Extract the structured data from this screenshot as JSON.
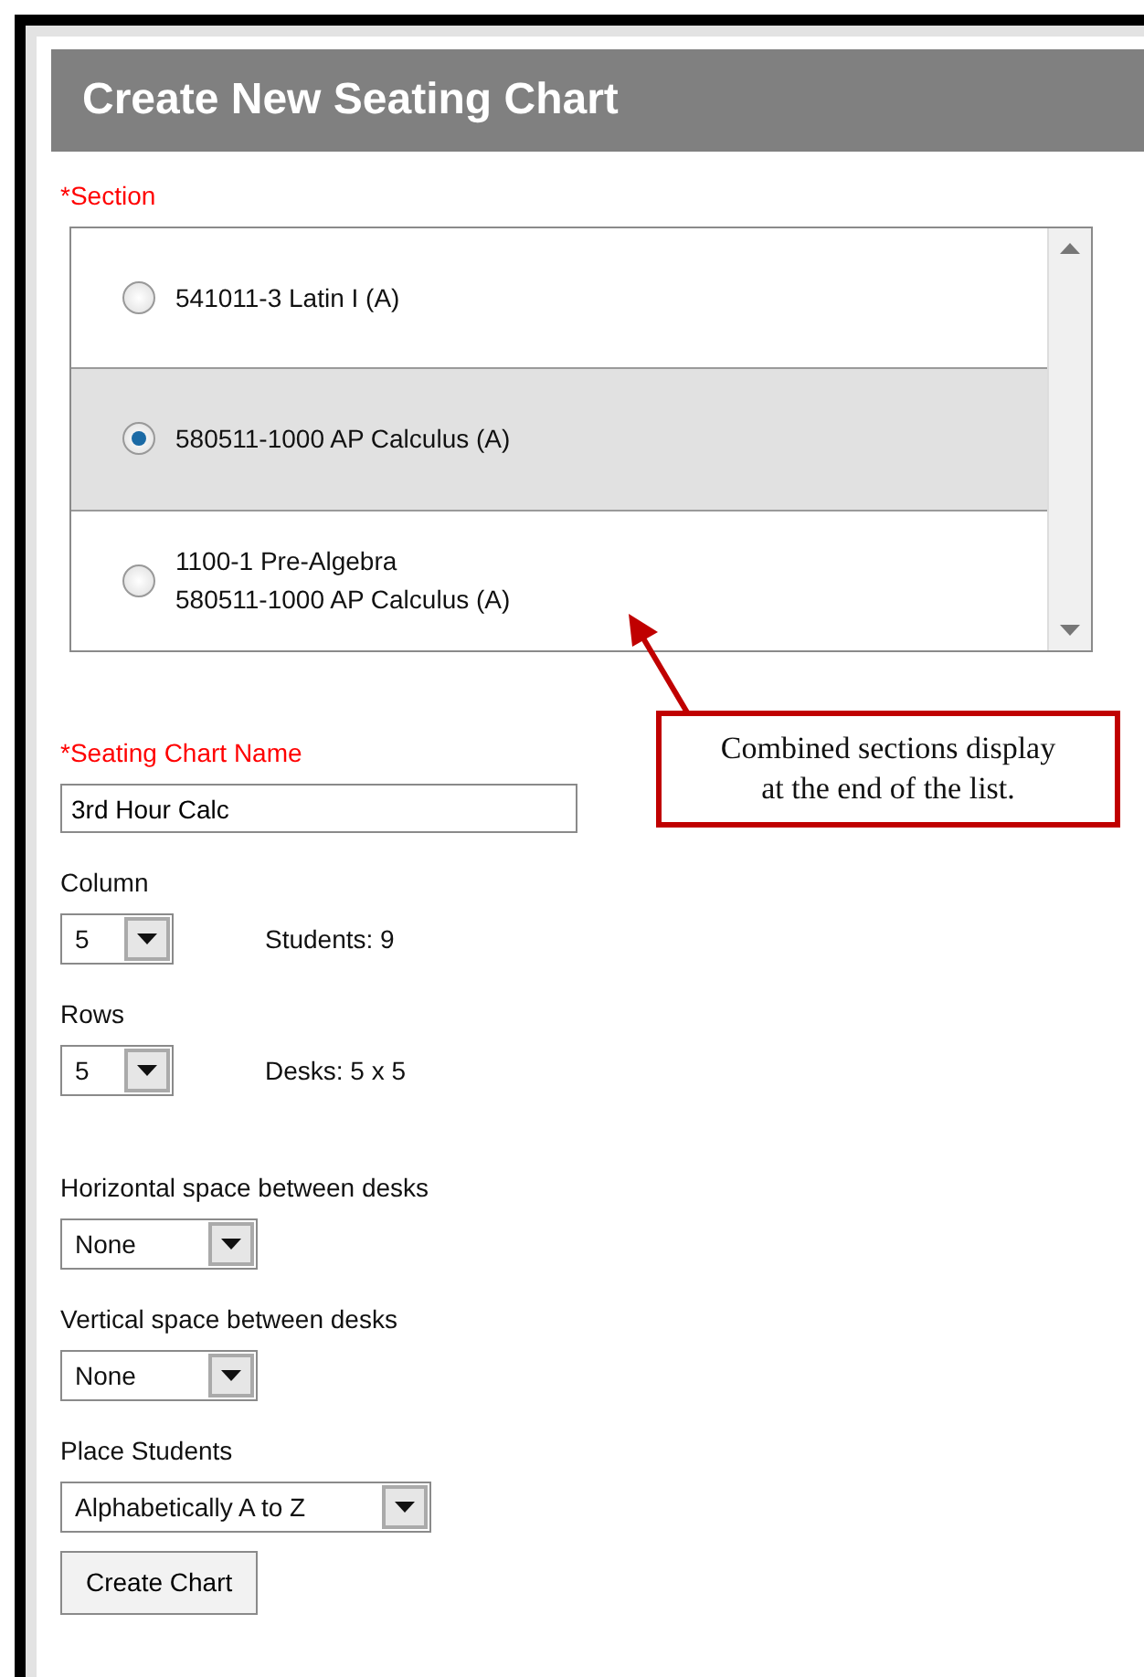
{
  "title": "Create New Seating Chart",
  "section": {
    "label": "*Section",
    "required": true,
    "options": [
      {
        "lines": [
          "541011-3 Latin I (A)"
        ],
        "selected": false
      },
      {
        "lines": [
          "580511-1000 AP Calculus (A)"
        ],
        "selected": true
      },
      {
        "lines": [
          "1100-1 Pre-Algebra",
          "580511-1000 AP Calculus (A)"
        ],
        "selected": false
      }
    ]
  },
  "callout": {
    "lines": [
      "Combined sections display",
      "at the end of the list."
    ]
  },
  "fields": [
    {
      "kind": "text",
      "label": "*Seating Chart Name",
      "required": true,
      "value": "3rd Hour Calc"
    },
    {
      "kind": "select",
      "label": "Column",
      "required": false,
      "value": "5",
      "info": "Students: 9"
    },
    {
      "kind": "select",
      "label": "Rows",
      "required": false,
      "value": "5",
      "info": "Desks: 5 x 5"
    },
    {
      "kind": "select",
      "label": "Horizontal space between desks",
      "required": false,
      "value": "None"
    },
    {
      "kind": "select",
      "label": "Vertical space between desks",
      "required": false,
      "value": "None"
    },
    {
      "kind": "select",
      "label": "Place Students",
      "required": false,
      "value": "Alphabetically A to Z"
    }
  ],
  "button": "Create Chart"
}
